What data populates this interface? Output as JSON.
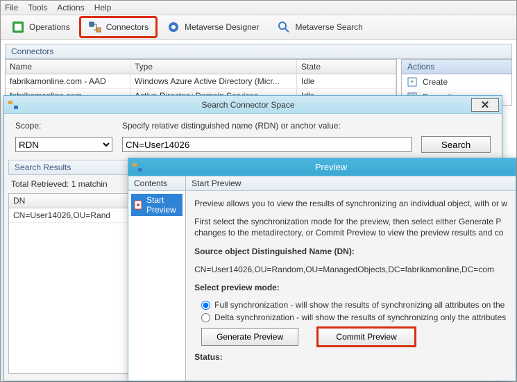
{
  "menubar": {
    "file": "File",
    "tools": "Tools",
    "actions": "Actions",
    "help": "Help"
  },
  "toolbar": {
    "operations": "Operations",
    "connectors": "Connectors",
    "mv_designer": "Metaverse Designer",
    "mv_search": "Metaverse Search"
  },
  "connectors": {
    "header": "Connectors",
    "cols": {
      "name": "Name",
      "type": "Type",
      "state": "State"
    },
    "rows": [
      {
        "name": "fabrikamonline.com - AAD",
        "type": "Windows Azure Active Directory (Micr...",
        "state": "Idle"
      },
      {
        "name": "fabrikamonline.com",
        "type": "Active Directory Domain Services",
        "state": "Idle"
      }
    ],
    "actions": {
      "header": "Actions",
      "items": [
        "Create",
        "Properties"
      ]
    }
  },
  "scs": {
    "title": "Search Connector Space",
    "scope_label": "Scope:",
    "instr": "Specify relative distinguished name (RDN) or anchor value:",
    "scope_value": "RDN",
    "rdn_value": "CN=User14026",
    "search_btn": "Search",
    "results_header": "Search Results",
    "total": "Total Retrieved: 1 matchin",
    "dn_col": "DN",
    "dn_row": "CN=User14026,OU=Rand"
  },
  "preview": {
    "title": "Preview",
    "contents_header": "Contents",
    "tree_item": "Start Preview",
    "main_header": "Start Preview",
    "p1": "Preview allows you to view the results of synchronizing an individual object, with or w",
    "p2": "First select the synchronization  mode for the preview, then select either Generate P",
    "p2b": "changes to the metadirectory, or Commit Preview to view the preview results and co",
    "dn_label": "Source object Distinguished Name (DN):",
    "dn_value": "CN=User14026,OU=Random,OU=ManagedObjects,DC=fabrikamonline,DC=com",
    "mode_label": "Select preview mode:",
    "opt_full": "Full synchronization - will show the results of synchronizing all attributes on the",
    "opt_delta": "Delta synchronization - will show the results of synchronizing only the attributes",
    "btn_generate": "Generate Preview",
    "btn_commit": "Commit Preview",
    "status_label": "Status:"
  }
}
